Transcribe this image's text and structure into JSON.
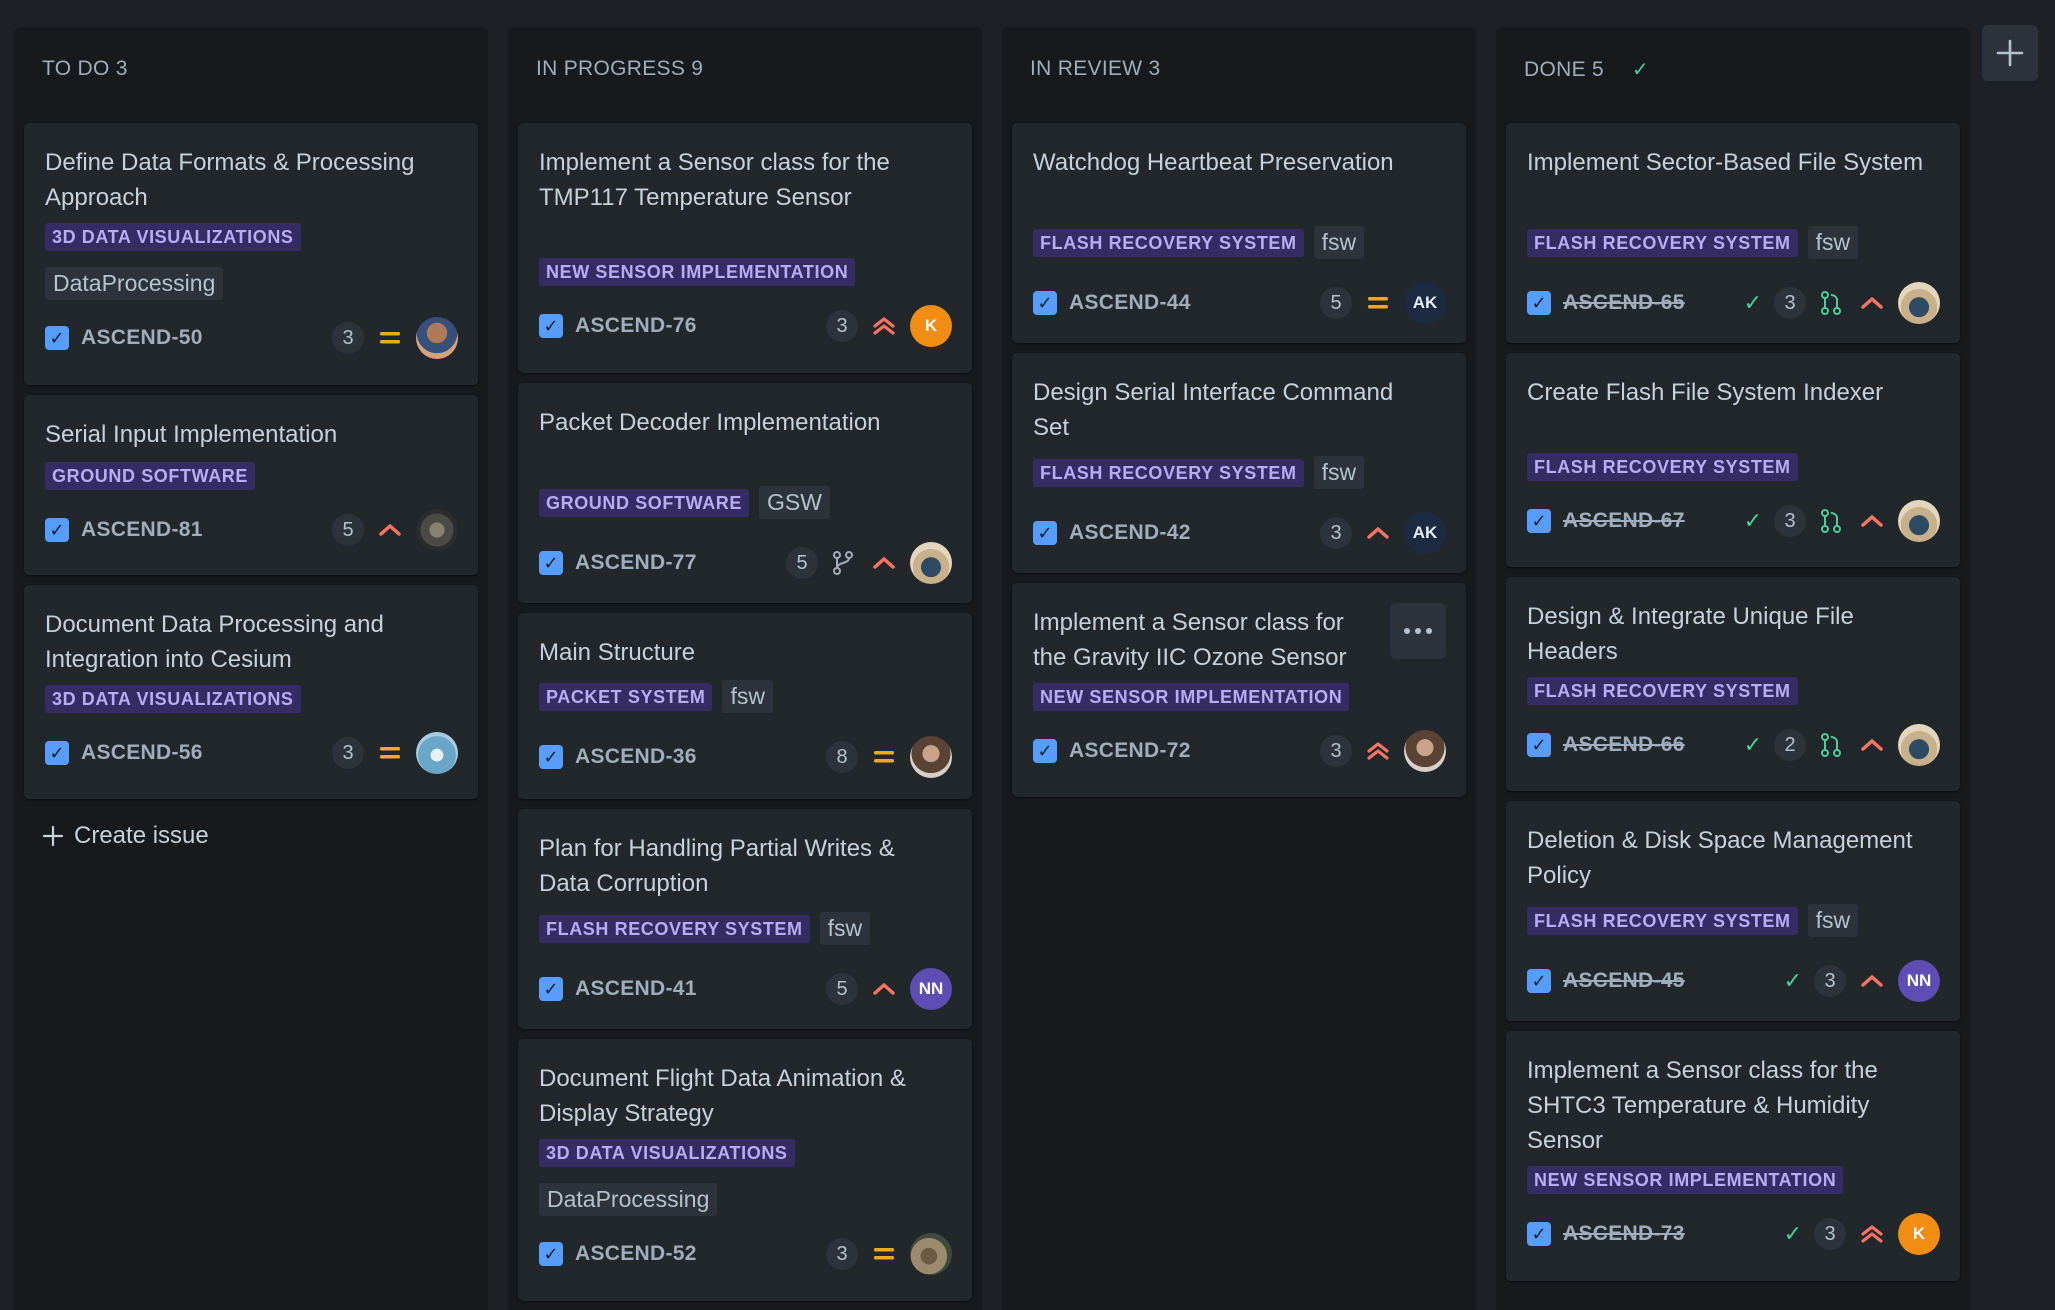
{
  "columns": [
    {
      "title": "TO DO 3",
      "create_label": "Create issue",
      "cards": [
        {
          "title": "Define Data Formats & Processing Approach",
          "epic": "3D DATA VISUALIZATIONS",
          "label": "DataProcessing",
          "key": "ASCEND-50",
          "estimate": "3",
          "priority": "medium",
          "avatar": ""
        },
        {
          "title": "Serial Input Implementation",
          "epic": "GROUND SOFTWARE",
          "key": "ASCEND-81",
          "estimate": "5",
          "priority": "high",
          "avatar": ""
        },
        {
          "title": "Document Data Processing and Integration into Cesium",
          "epic": "3D DATA VISUALIZATIONS",
          "key": "ASCEND-56",
          "estimate": "3",
          "priority": "medium",
          "avatar": ""
        }
      ]
    },
    {
      "title": "IN PROGRESS 9",
      "cards": [
        {
          "title": "Implement a Sensor class for the TMP117 Temperature Sensor",
          "epic": "NEW SENSOR IMPLEMENTATION",
          "key": "ASCEND-76",
          "estimate": "3",
          "priority": "highest",
          "avatar": "K"
        },
        {
          "title": "Packet Decoder Implementation",
          "epic": "GROUND SOFTWARE",
          "label": "GSW",
          "key": "ASCEND-77",
          "estimate": "5",
          "branch": true,
          "priority": "high",
          "avatar": ""
        },
        {
          "title": "Main Structure",
          "epic": "PACKET SYSTEM",
          "label": "fsw",
          "key": "ASCEND-36",
          "estimate": "8",
          "priority": "medium",
          "avatar": ""
        },
        {
          "title": "Plan for Handling Partial Writes & Data Corruption",
          "epic": "FLASH RECOVERY SYSTEM",
          "label": "fsw",
          "key": "ASCEND-41",
          "estimate": "5",
          "priority": "high",
          "avatar": "NN"
        },
        {
          "title": "Document Flight Data Animation & Display Strategy",
          "epic": "3D DATA VISUALIZATIONS",
          "label": "DataProcessing",
          "key": "ASCEND-52",
          "estimate": "3",
          "priority": "medium",
          "avatar": ""
        }
      ]
    },
    {
      "title": "IN REVIEW 3",
      "cards": [
        {
          "title": "Watchdog Heartbeat Preservation",
          "epic": "FLASH RECOVERY SYSTEM",
          "label": "fsw",
          "key": "ASCEND-44",
          "estimate": "5",
          "priority": "medium",
          "avatar": "AK"
        },
        {
          "title": "Design Serial Interface Command Set",
          "epic": "FLASH RECOVERY SYSTEM",
          "label": "fsw",
          "key": "ASCEND-42",
          "estimate": "3",
          "priority": "high",
          "avatar": "AK"
        },
        {
          "title": "Implement a Sensor class for the Gravity IIC Ozone Sensor",
          "epic": "NEW SENSOR IMPLEMENTATION",
          "key": "ASCEND-72",
          "estimate": "3",
          "priority": "highest",
          "avatar": ""
        }
      ]
    },
    {
      "title": "DONE 5",
      "cards": [
        {
          "title": "Implement Sector-Based File System",
          "epic": "FLASH RECOVERY SYSTEM",
          "label": "fsw",
          "key": "ASCEND-65",
          "estimate": "3",
          "branch": true,
          "priority": "high",
          "avatar": ""
        },
        {
          "title": "Create Flash File System Indexer",
          "epic": "FLASH RECOVERY SYSTEM",
          "key": "ASCEND-67",
          "estimate": "3",
          "branch": true,
          "priority": "high",
          "avatar": ""
        },
        {
          "title": "Design & Integrate Unique File Headers",
          "epic": "FLASH RECOVERY SYSTEM",
          "key": "ASCEND-66",
          "estimate": "2",
          "branch": true,
          "priority": "high",
          "avatar": ""
        },
        {
          "title": "Deletion & Disk Space Management Policy",
          "epic": "FLASH RECOVERY SYSTEM",
          "label": "fsw",
          "key": "ASCEND-45",
          "estimate": "3",
          "priority": "high",
          "avatar": "NN"
        },
        {
          "title": "Implement a Sensor class for the SHTC3 Temperature & Humidity Sensor",
          "epic": "NEW SENSOR IMPLEMENTATION",
          "key": "ASCEND-73",
          "estimate": "3",
          "priority": "highest",
          "avatar": "K"
        }
      ]
    }
  ],
  "colors": {
    "background": "#1d2125",
    "column": "#161a1d",
    "card": "#22272b",
    "epic_bg": "#352c63",
    "epic_text": "#b8acf6",
    "checkbox": "#579dff",
    "priority_medium": "#f5a623",
    "priority_high": "#f87462",
    "done_green": "#4bce97"
  }
}
